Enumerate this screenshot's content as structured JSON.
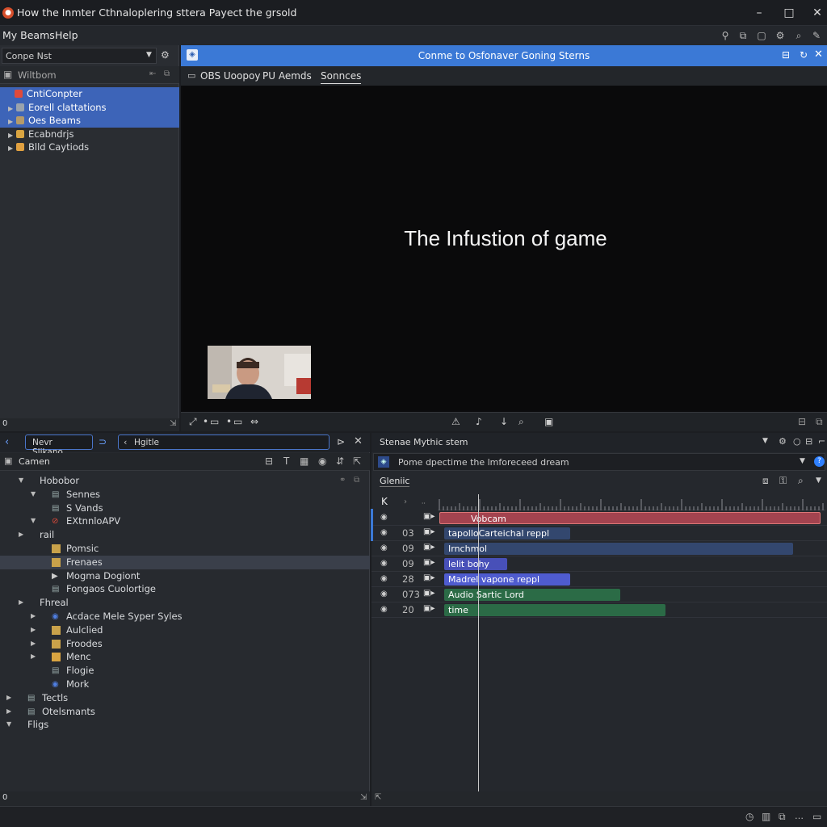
{
  "window": {
    "title": "How the Inmter Cthnaloplering sttera Payect the grsold",
    "controls": {
      "minimize": "–",
      "maximize": "□",
      "close": "✕"
    }
  },
  "menu": {
    "items": [
      "My Beams",
      "Help"
    ]
  },
  "left_panel": {
    "dropdown_value": "Conpe Nst",
    "title": "Wiltbom",
    "tree": [
      {
        "label": "CntiConpter",
        "arrow": "",
        "icon_color": "#e04a3a",
        "selected": true
      },
      {
        "label": "Eorell clattations",
        "arrow": "▶",
        "icon_color": "#9aa3ad",
        "selected": true
      },
      {
        "label": "Oes Beams",
        "arrow": "▶",
        "icon_color": "#b59b6a",
        "selected": true
      },
      {
        "label": "Ecabndrjs",
        "arrow": "▶",
        "icon_color": "#d9a441",
        "selected": false
      },
      {
        "label": "Blld Caytiods",
        "arrow": "▶",
        "icon_color": "#e0a040",
        "selected": false
      }
    ],
    "status_left": "0"
  },
  "preview": {
    "header_title": "Conme to Osfonaver Goning Sterns",
    "tabs": [
      "OBS Uoopoy",
      "PU Aemds",
      "Sonnces"
    ],
    "overlay_text": "The Infustion of game"
  },
  "bottom_left": {
    "nav_pill": "Nevr Slikano...",
    "search_value": "Hgitle",
    "header_title": "Camen",
    "tree": [
      {
        "label": "Hobobor",
        "arrow": "▼",
        "depth": 1,
        "icon": "none"
      },
      {
        "label": "Sennes",
        "arrow": "▼",
        "depth": 2,
        "icon": "list"
      },
      {
        "label": "S Vands",
        "arrow": "",
        "depth": 2,
        "icon": "list"
      },
      {
        "label": "EXtnnloAPV",
        "arrow": "▼",
        "depth": 2,
        "icon": "red"
      },
      {
        "label": "rail",
        "arrow": "▶",
        "depth": 1,
        "icon": "none"
      },
      {
        "label": "Pomsic",
        "arrow": "",
        "depth": 2,
        "icon": "gold"
      },
      {
        "label": "Frenaes",
        "arrow": "",
        "depth": 2,
        "icon": "gold",
        "selected": true
      },
      {
        "label": "Mogma Dogiont",
        "arrow": "",
        "depth": 2,
        "icon": "play"
      },
      {
        "label": "Fongaos Cuolortige",
        "arrow": "",
        "depth": 2,
        "icon": "list"
      },
      {
        "label": "Fhreal",
        "arrow": "▶",
        "depth": 1,
        "icon": "none"
      },
      {
        "label": "Acdace Mele Syper Syles",
        "arrow": "▶",
        "depth": 2,
        "icon": "blue"
      },
      {
        "label": "Aulclied",
        "arrow": "▶",
        "depth": 2,
        "icon": "gold"
      },
      {
        "label": "Froodes",
        "arrow": "▶",
        "depth": 2,
        "icon": "gold"
      },
      {
        "label": "Menc",
        "arrow": "▶",
        "depth": 2,
        "icon": "folder"
      },
      {
        "label": "Flogie",
        "arrow": "",
        "depth": 2,
        "icon": "list"
      },
      {
        "label": "Mork",
        "arrow": "",
        "depth": 2,
        "icon": "blue"
      },
      {
        "label": "Tectls",
        "arrow": "▶",
        "depth": 0,
        "icon": "list"
      },
      {
        "label": "Otelsmants",
        "arrow": "▶",
        "depth": 0,
        "icon": "list"
      },
      {
        "label": "Fligs",
        "arrow": "▼",
        "depth": 0,
        "icon": "none"
      }
    ],
    "status_left": "0"
  },
  "bottom_right": {
    "title": "Stenae Mythic stem",
    "search_value": "Pome dpectime the lmforeceed dream",
    "section_label": "Gleniic",
    "track_label": "K",
    "tracks": [
      {
        "num": "",
        "clip": "Vobcam",
        "color": "#a3434f",
        "start": 0,
        "width": 472
      },
      {
        "num": "03",
        "clip": "tapolloCarteichal reppl",
        "color": "#33476e",
        "start": 6,
        "width": 156
      },
      {
        "num": "09",
        "clip": "Irnchmol",
        "color": "#33476e",
        "start": 6,
        "width": 432
      },
      {
        "num": "09",
        "clip": "lelit bohy",
        "color": "#4850b8",
        "start": 6,
        "width": 78
      },
      {
        "num": "28",
        "clip": "Madrel vapone reppl",
        "color": "#4f5ccf",
        "start": 6,
        "width": 156
      },
      {
        "num": "073",
        "clip": "Audio Sartic Lord",
        "color": "#2b6b46",
        "start": 6,
        "width": 218
      },
      {
        "num": "20",
        "clip": "time",
        "color": "#2b6b46",
        "start": 6,
        "width": 274
      }
    ]
  },
  "colors": {
    "accent": "#3b79d6",
    "selection": "#3d64b8",
    "background": "#1c1e22"
  }
}
